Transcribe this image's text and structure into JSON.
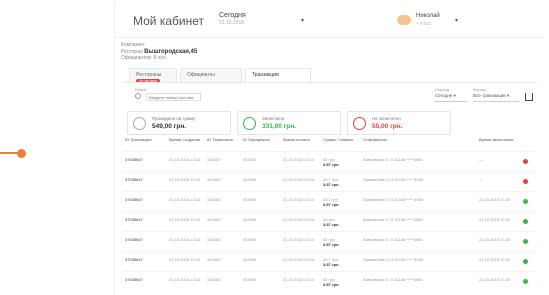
{
  "header": {
    "title": "Мой кабинет",
    "date_label": "Сегодня",
    "date_value": "21.10.2018",
    "user_name": "Николай",
    "user_sub": "+ 0 012"
  },
  "info": {
    "line1": "Компания:",
    "line2_prefix": "Ресторан",
    "line2_bold": "Вышгородская,45",
    "line3": "Официантов: 8 чел."
  },
  "tabs": [
    {
      "label": "Рестораны",
      "badge": "Не активен"
    },
    {
      "label": "Официанты"
    },
    {
      "label": "Транзакции"
    }
  ],
  "search": {
    "label": "Поиск",
    "placeholder": "Введите номер или имя"
  },
  "controls": {
    "period_label": "Период",
    "period_value": "Сегодня",
    "filter_label": "Фильтр",
    "filter_value": "Все транзакции"
  },
  "cards": [
    {
      "label": "Проведено на сумму",
      "value": "549,00 грн.",
      "ring_color": "#aaaaaa"
    },
    {
      "label": "Зачислено",
      "value": "331,00 грн.",
      "ring_color": "#39b54a"
    },
    {
      "label": "Не зачислено",
      "value": "55,00 грн.",
      "ring_color": "#e84040"
    }
  ],
  "table": {
    "columns": [
      "ID Транзакции",
      "Время Создания",
      "ID Терминала",
      "ID Официанта",
      "Время оплаты",
      "Сумма / Чаевые",
      "Отправитель",
      "Время зачисления"
    ],
    "rows": [
      {
        "id": "47035647",
        "created": "21.10.2018 13:14",
        "terminal": "443457",
        "waiter": "443457",
        "paid": "21.10.2018 13:14",
        "amount": "44 грн.",
        "tips": "3.87 грн.",
        "sender": "Банковская 4 / 5 31148 **** 6985",
        "credited": "—",
        "status": "#e84040"
      },
      {
        "id": "47035647",
        "created": "21.10.2018 13:14",
        "terminal": "443453",
        "waiter": "443453",
        "paid": "21.10.2018 13:14",
        "amount": "25.7 грн.",
        "tips": "3.87 грн.",
        "sender": "Приватбанк 4 / 5 31148 **** 6985",
        "credited": "—",
        "status": "#e84040"
      },
      {
        "id": "47035647",
        "created": "21.10.2018 13:14",
        "terminal": "443453",
        "waiter": "443453",
        "paid": "21.10.2018 13:14",
        "amount": "25.7 грн.",
        "tips": "3.87 грн.",
        "sender": "Приватбанк 4 / 5 31148 **** 6985",
        "credited": "21.10.2018 13:20",
        "status": "#39b54a"
      },
      {
        "id": "47035647",
        "created": "21.10.2018 13:14",
        "terminal": "443453",
        "waiter": "443453",
        "paid": "21.10.2018 13:14",
        "amount": "44 грн.",
        "tips": "3.87 грн.",
        "sender": "Банковская 4 / 5 31148 **** 6985",
        "credited": "21.10.2018 13:20",
        "status": "#39b54a"
      },
      {
        "id": "47035647",
        "created": "21.10.2018 13:14",
        "terminal": "443453",
        "waiter": "443453",
        "paid": "21.10.2018 13:14",
        "amount": "44 грн.",
        "tips": "3.87 грн.",
        "sender": "Банковская 4 / 5 31148 **** 6985",
        "credited": "21.10.2018 13:20",
        "status": "#39b54a"
      },
      {
        "id": "47035647",
        "created": "21.10.2018 13:14",
        "terminal": "443453",
        "waiter": "443453",
        "paid": "21.10.2018 13:14",
        "amount": "25.7 грн.",
        "tips": "3.87 грн.",
        "sender": "Приватбанк 4 / 5 31148 **** 6985",
        "credited": "21.10.2018 13:20",
        "status": "#39b54a"
      },
      {
        "id": "47035647",
        "created": "21.10.2018 13:14",
        "terminal": "443453",
        "waiter": "443453",
        "paid": "21.10.2018 13:14",
        "amount": "44 грн.",
        "tips": "3.87 грн.",
        "sender": "Банковская 4 / 5 31148 **** 6985",
        "credited": "21.10.2018 13:20",
        "status": "#39b54a"
      }
    ]
  }
}
